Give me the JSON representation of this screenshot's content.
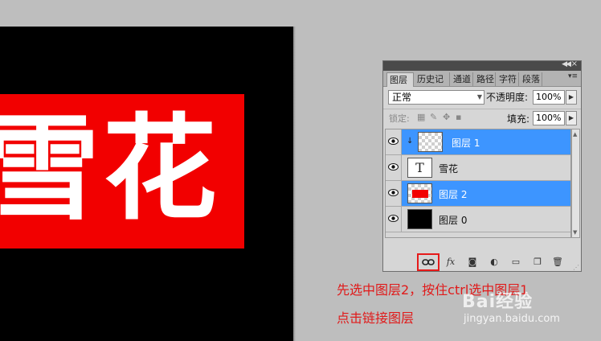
{
  "canvas": {
    "art_text": "雪花"
  },
  "panel": {
    "tabs": [
      "图层",
      "历史记",
      "通道",
      "路径",
      "字符",
      "段落"
    ],
    "active_tab": "图层",
    "blend_mode": "正常",
    "opacity_label": "不透明度:",
    "opacity_value": "100%",
    "lock_label": "锁定:",
    "fill_label": "填充:",
    "fill_value": "100%",
    "layers": [
      {
        "name": "图层 1",
        "selected": true,
        "thumb": "checker",
        "clipped": true
      },
      {
        "name": "雪花",
        "selected": false,
        "thumb": "text",
        "thumb_glyph": "T"
      },
      {
        "name": "图层 2",
        "selected": true,
        "thumb": "red"
      },
      {
        "name": "图层 0",
        "selected": false,
        "thumb": "black"
      }
    ],
    "toolbar_icons": [
      "link-layers-icon",
      "fx-icon",
      "mask-icon",
      "adjustment-icon",
      "group-folder-icon",
      "new-layer-icon",
      "trash-icon"
    ],
    "fx_glyph": "fx"
  },
  "instructions": {
    "line1": "先选中图层2，按住ctrl选中图层1",
    "line2": "点击链接图层"
  },
  "watermark": {
    "logo": "Bai经验",
    "url": "jingyan.baidu.com"
  },
  "colors": {
    "selection_blue": "#3d95ff",
    "canvas_red": "#f20000",
    "note_red": "#e01a1a"
  }
}
